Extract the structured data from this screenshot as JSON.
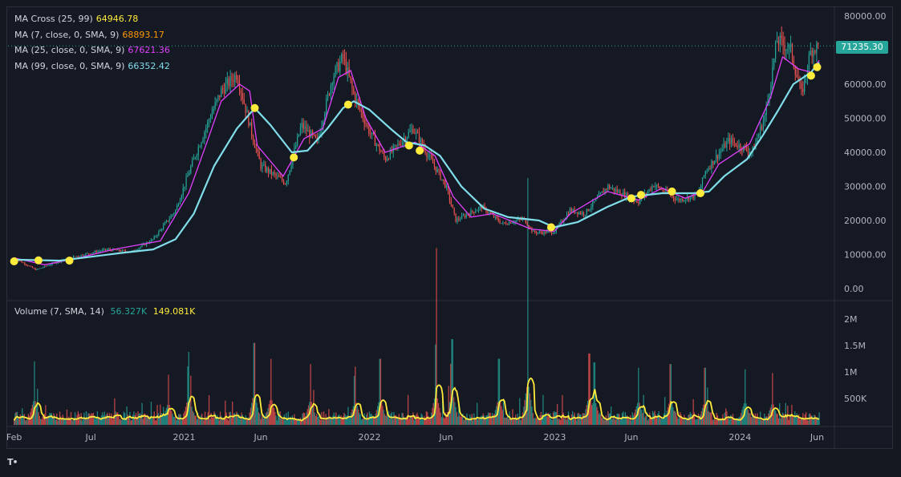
{
  "chart_data": {
    "type": "candlestick",
    "symbol_price_tag": "71235.30",
    "price_axis": {
      "ticks": [
        "80000.00",
        "70000.00",
        "60000.00",
        "50000.00",
        "40000.00",
        "30000.00",
        "20000.00",
        "10000.00",
        "0.00"
      ],
      "ylim": [
        0,
        80000
      ]
    },
    "volume_axis": {
      "ticks": [
        "2M",
        "1.5M",
        "1M",
        "500K"
      ],
      "ylim": [
        0,
        2000000
      ]
    },
    "x_ticks": [
      "Feb",
      "Jul",
      "2021",
      "Jun",
      "2022",
      "Jun",
      "2023",
      "Jun",
      "2024",
      "Jun"
    ],
    "x_range": [
      "2020-02",
      "2024-06"
    ],
    "legend": [
      {
        "label": "MA Cross (25, 99)",
        "value": "64946.78",
        "color": "#ffeb3b"
      },
      {
        "label": "MA (7, close, 0, SMA, 9)",
        "value": "68893.17",
        "color": "#ff9800"
      },
      {
        "label": "MA (25, close, 0, SMA, 9)",
        "value": "67621.36",
        "color": "#e040fb"
      },
      {
        "label": "MA (99, close, 0, SMA, 9)",
        "value": "66352.42",
        "color": "#80deea"
      }
    ],
    "volume_legend": {
      "label": "Volume (7, SMA, 14)",
      "value1": "56.327K",
      "value2": "149.081K",
      "color1": "#26a69a",
      "color2": "#ffeb3b"
    },
    "price_path": [
      [
        "2020-02-01",
        9000
      ],
      [
        "2020-03-15",
        5500
      ],
      [
        "2020-04-20",
        7500
      ],
      [
        "2020-06-01",
        9500
      ],
      [
        "2020-08-01",
        11500
      ],
      [
        "2020-09-20",
        10800
      ],
      [
        "2020-11-01",
        14500
      ],
      [
        "2020-12-15",
        23000
      ],
      [
        "2021-01-15",
        36000
      ],
      [
        "2021-02-20",
        50000
      ],
      [
        "2021-03-15",
        58000
      ],
      [
        "2021-04-15",
        63000
      ],
      [
        "2021-05-15",
        45000
      ],
      [
        "2021-06-01",
        36000
      ],
      [
        "2021-07-01",
        33000
      ],
      [
        "2021-07-20",
        31000
      ],
      [
        "2021-08-20",
        48000
      ],
      [
        "2021-09-20",
        43000
      ],
      [
        "2021-10-20",
        62000
      ],
      [
        "2021-11-10",
        68000
      ],
      [
        "2021-12-01",
        57000
      ],
      [
        "2022-01-01",
        46000
      ],
      [
        "2022-02-01",
        38000
      ],
      [
        "2022-03-28",
        47000
      ],
      [
        "2022-05-01",
        38000
      ],
      [
        "2022-06-01",
        30000
      ],
      [
        "2022-06-20",
        20000
      ],
      [
        "2022-08-10",
        24000
      ],
      [
        "2022-09-20",
        19000
      ],
      [
        "2022-11-01",
        20500
      ],
      [
        "2022-11-20",
        16500
      ],
      [
        "2022-12-31",
        16600
      ],
      [
        "2023-01-31",
        23000
      ],
      [
        "2023-03-01",
        22000
      ],
      [
        "2023-04-15",
        30000
      ],
      [
        "2023-06-15",
        25500
      ],
      [
        "2023-07-15",
        30500
      ],
      [
        "2023-09-01",
        26000
      ],
      [
        "2023-10-10",
        27500
      ],
      [
        "2023-10-25",
        34500
      ],
      [
        "2023-12-10",
        43500
      ],
      [
        "2024-01-25",
        40000
      ],
      [
        "2024-02-20",
        51000
      ],
      [
        "2024-03-14",
        73000
      ],
      [
        "2024-04-10",
        70000
      ],
      [
        "2024-05-01",
        57000
      ],
      [
        "2024-05-20",
        70000
      ],
      [
        "2024-06-05",
        71235
      ]
    ],
    "ma25_path": [
      [
        "2020-02-01",
        9000
      ],
      [
        "2020-04-01",
        7000
      ],
      [
        "2020-06-15",
        9300
      ],
      [
        "2020-08-15",
        11500
      ],
      [
        "2020-11-15",
        14000
      ],
      [
        "2021-01-10",
        28000
      ],
      [
        "2021-02-15",
        43000
      ],
      [
        "2021-03-15",
        55000
      ],
      [
        "2021-04-20",
        60000
      ],
      [
        "2021-05-10",
        58000
      ],
      [
        "2021-05-25",
        42000
      ],
      [
        "2021-07-15",
        33000
      ],
      [
        "2021-08-25",
        44000
      ],
      [
        "2021-10-01",
        47000
      ],
      [
        "2021-11-01",
        62000
      ],
      [
        "2021-11-25",
        64000
      ],
      [
        "2021-12-25",
        50000
      ],
      [
        "2022-02-01",
        40000
      ],
      [
        "2022-04-01",
        43000
      ],
      [
        "2022-05-10",
        39000
      ],
      [
        "2022-06-15",
        27000
      ],
      [
        "2022-07-20",
        21000
      ],
      [
        "2022-09-01",
        22000
      ],
      [
        "2022-11-15",
        17500
      ],
      [
        "2022-12-31",
        16800
      ],
      [
        "2023-02-01",
        22000
      ],
      [
        "2023-04-15",
        28500
      ],
      [
        "2023-06-15",
        26000
      ],
      [
        "2023-08-01",
        29500
      ],
      [
        "2023-09-15",
        26500
      ],
      [
        "2023-10-20",
        28500
      ],
      [
        "2023-11-20",
        36500
      ],
      [
        "2024-01-20",
        42500
      ],
      [
        "2024-03-01",
        56000
      ],
      [
        "2024-03-25",
        68000
      ],
      [
        "2024-04-25",
        64500
      ],
      [
        "2024-05-20",
        63500
      ],
      [
        "2024-06-05",
        67000
      ]
    ],
    "ma99_path": [
      [
        "2020-02-01",
        8500
      ],
      [
        "2020-05-01",
        8200
      ],
      [
        "2020-09-01",
        10500
      ],
      [
        "2020-11-01",
        11500
      ],
      [
        "2020-12-15",
        14500
      ],
      [
        "2021-01-20",
        22000
      ],
      [
        "2021-03-01",
        36000
      ],
      [
        "2021-04-15",
        47000
      ],
      [
        "2021-05-20",
        53000
      ],
      [
        "2021-06-20",
        48000
      ],
      [
        "2021-08-01",
        40000
      ],
      [
        "2021-09-01",
        40500
      ],
      [
        "2021-10-10",
        47000
      ],
      [
        "2021-11-10",
        53000
      ],
      [
        "2021-12-01",
        55000
      ],
      [
        "2022-01-01",
        52500
      ],
      [
        "2022-02-15",
        46500
      ],
      [
        "2022-03-15",
        43000
      ],
      [
        "2022-04-20",
        42000
      ],
      [
        "2022-05-20",
        39000
      ],
      [
        "2022-07-01",
        30000
      ],
      [
        "2022-08-15",
        23500
      ],
      [
        "2022-10-01",
        21000
      ],
      [
        "2022-12-01",
        20000
      ],
      [
        "2022-12-31",
        18000
      ],
      [
        "2023-02-15",
        19500
      ],
      [
        "2023-04-15",
        24000
      ],
      [
        "2023-06-01",
        27000
      ],
      [
        "2023-08-01",
        28000
      ],
      [
        "2023-10-01",
        28000
      ],
      [
        "2023-11-01",
        28500
      ],
      [
        "2023-12-01",
        33000
      ],
      [
        "2024-01-15",
        38000
      ],
      [
        "2024-02-15",
        45000
      ],
      [
        "2024-03-15",
        52000
      ],
      [
        "2024-04-15",
        60000
      ],
      [
        "2024-05-20",
        63500
      ],
      [
        "2024-06-05",
        66352
      ]
    ],
    "cross_points": [
      [
        "2020-02-01",
        8000
      ],
      [
        "2020-03-20",
        8300
      ],
      [
        "2020-05-20",
        8200
      ],
      [
        "2021-05-20",
        53000
      ],
      [
        "2021-08-05",
        38500
      ],
      [
        "2021-11-20",
        54000
      ],
      [
        "2022-03-20",
        42000
      ],
      [
        "2022-04-10",
        40500
      ],
      [
        "2022-12-25",
        18000
      ],
      [
        "2023-06-01",
        26500
      ],
      [
        "2023-06-20",
        27500
      ],
      [
        "2023-08-20",
        28500
      ],
      [
        "2023-10-15",
        28000
      ],
      [
        "2024-05-20",
        62500
      ],
      [
        "2024-06-01",
        65000
      ]
    ],
    "volume_spikes": [
      [
        "2020-03-12",
        1200000
      ],
      [
        "2020-12-01",
        950000
      ],
      [
        "2021-01-10",
        1380000
      ],
      [
        "2021-05-19",
        1550000
      ],
      [
        "2021-06-21",
        1250000
      ],
      [
        "2021-09-07",
        1150000
      ],
      [
        "2021-12-04",
        1100000
      ],
      [
        "2022-01-22",
        1250000
      ],
      [
        "2022-05-12",
        1520000
      ],
      [
        "2022-06-13",
        1620000
      ],
      [
        "2022-09-13",
        1250000
      ],
      [
        "2022-11-09",
        2120000
      ],
      [
        "2023-03-10",
        1350000
      ],
      [
        "2023-03-20",
        1180000
      ],
      [
        "2023-06-15",
        1080000
      ],
      [
        "2023-08-17",
        1150000
      ],
      [
        "2023-10-24",
        1080000
      ],
      [
        "2024-01-11",
        1050000
      ],
      [
        "2024-03-05",
        980000
      ]
    ]
  }
}
